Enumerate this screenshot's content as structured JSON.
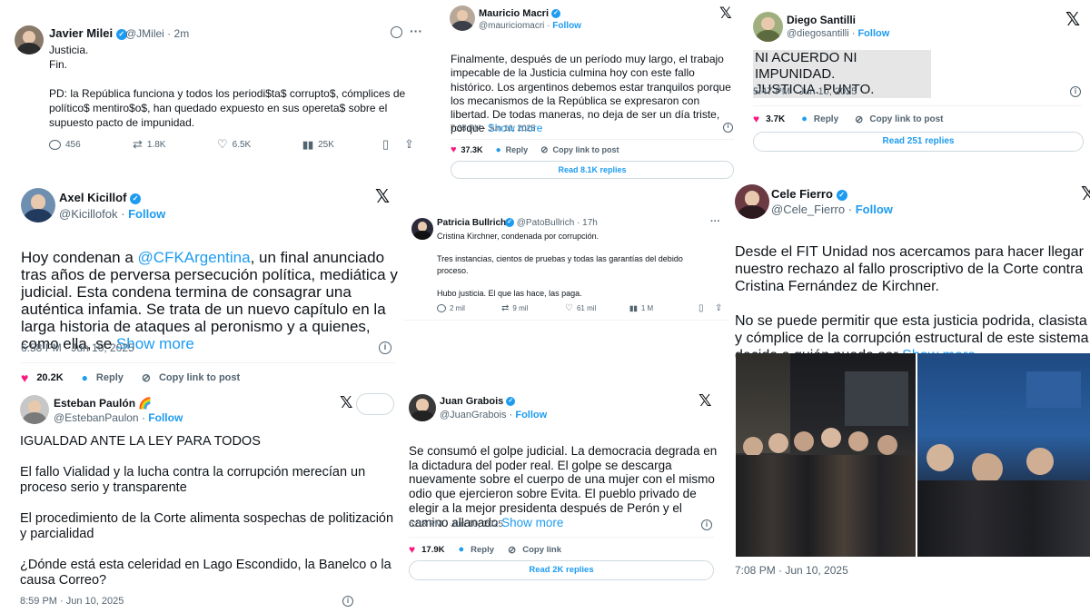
{
  "milei": {
    "name": "Javier Milei",
    "handle": "@JMilei · 2m",
    "text": "Justicia.\nFin.\n\nPD: la República funciona y todos los periodi$ta$ corrupto$, cómplices de político$ mentiro$o$, han quedado expuesto en sus opereta$ sobre el supuesto pacto de impunidad.",
    "replies": "456",
    "reposts": "1.8K",
    "likes": "6.5K",
    "views": "25K"
  },
  "macri": {
    "name": "Mauricio Macri",
    "handle": "@mauriciomacri",
    "follow": "Follow",
    "text": "Finalmente, después de un período muy largo, el trabajo impecable de la Justicia culmina hoy con este fallo histórico. Los argentinos debemos estar tranquilos porque los mecanismos de la República se expresaron con libertad. De todas maneras, no deja de ser un día triste, porque",
    "show_more": "Show more",
    "time": "7:35 PM · Jun 10, 2025",
    "likes": "37.3K",
    "reply": "Reply",
    "copy": "Copy link to post",
    "read": "Read 8.1K replies"
  },
  "santilli": {
    "name": "Diego Santilli",
    "handle": "@diegosantilli",
    "follow": "Follow",
    "text": "NI ACUERDO NI IMPUNIDAD.\nJUSTICIA. PUNTO.",
    "time": "5:47 PM · Jun 10, 2025",
    "likes": "3.7K",
    "reply": "Reply",
    "copy": "Copy link to post",
    "read": "Read 251 replies"
  },
  "kicillof": {
    "name": "Axel Kicillof",
    "handle": "@Kicillofok",
    "follow": "Follow",
    "text_before": "Hoy condenan a ",
    "mention": "@CFKArgentina",
    "text_after": ", un final anunciado tras años de perversa persecución política, mediática y judicial. Esta condena termina de consagrar una auténtica infamia. Se trata de un nuevo capítulo en la larga historia de ataques al peronismo y a quienes, como ella, se",
    "show_more": "Show more",
    "time": "6:58 PM · Jun 10, 2025",
    "likes": "20.2K",
    "reply": "Reply",
    "copy": "Copy link to post"
  },
  "bullrich": {
    "name": "Patricia Bullrich",
    "handle": "@PatoBullrich · 17h",
    "text": "Cristina Kirchner, condenada por corrupción.\n\nTres instancias, cientos de pruebas y todas las garantías del debido proceso.\n\nHubo justicia. El que las hace, las paga.",
    "replies": "2 mil",
    "reposts": "9 mil",
    "likes": "61 mil",
    "views": "1 M"
  },
  "fierro": {
    "name": "Cele Fierro",
    "handle": "@Cele_Fierro",
    "follow": "Follow",
    "text": "Desde el FIT Unidad nos acercamos para hacer llegar nuestro rechazo al fallo proscriptivo de la Corte contra Cristina Fernández de Kirchner.\n\nNo se puede permitir que esta justicia podrida, clasista y cómplice de la corrupción estructural de este sistema decida a quién pueda ser",
    "show_more": "Show more",
    "time": "7:08 PM · Jun 10, 2025"
  },
  "paulon": {
    "name": "Esteban Paulón 🌈",
    "handle": "@EstebanPaulon",
    "follow": "Follow",
    "text": "IGUALDAD ANTE LA LEY PARA TODOS\n\nEl fallo Vialidad y la lucha contra la corrupción merecían un proceso serio y transparente\n\nEl procedimiento de la Corte alimenta sospechas de politización y parcialidad\n\n¿Dónde está esta celeridad en Lago Escondido, la Banelco o la causa Correo?",
    "time": "8:59 PM · Jun 10, 2025"
  },
  "grabois": {
    "name": "Juan Grabois",
    "handle": "@JuanGrabois",
    "follow": "Follow",
    "text": "Se consumó el golpe judicial. La democracia degrada en la dictadura del poder real. El golpe se descarga nuevamente sobre el cuerpo de una mujer con el mismo odio que ejercieron sobre Evita. El pueblo privado de elegir a la mejor presidenta después de Perón y el camino allanado",
    "show_more": "Show more",
    "time": "6:58 PM · Jun 10, 2025",
    "likes": "17.9K",
    "reply": "Reply",
    "copy": "Copy link",
    "read": "Read 2K replies"
  },
  "icons": {
    "dot": "·",
    "x_logo": "𝕏",
    "check": "✓",
    "info": "i"
  },
  "colors": {
    "accent": "#1d9bf0",
    "like": "#f91880",
    "muted": "#536471"
  }
}
